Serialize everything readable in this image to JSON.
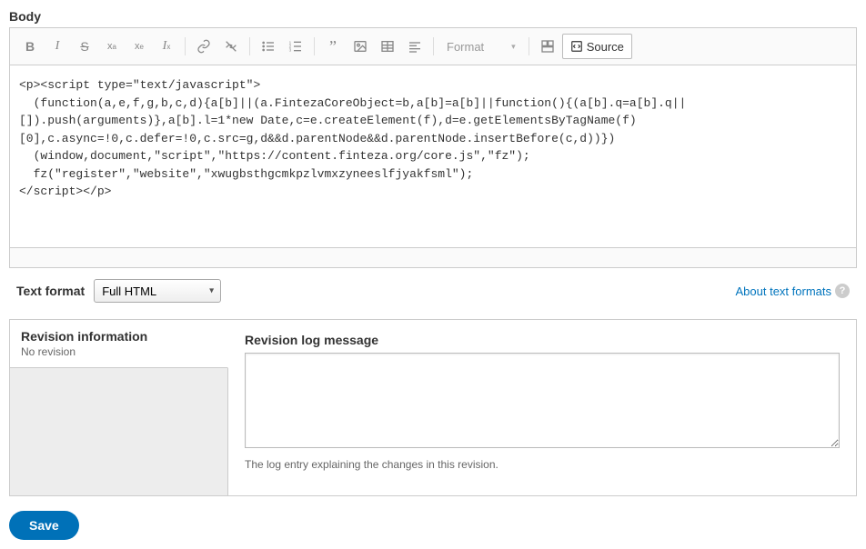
{
  "body_label": "Body",
  "toolbar": {
    "format_label": "Format",
    "source_label": "Source"
  },
  "editor_content": "<p><script type=\"text/javascript\">\n  (function(a,e,f,g,b,c,d){a[b]||(a.FintezaCoreObject=b,a[b]=a[b]||function(){(a[b].q=a[b].q||\n[]).push(arguments)},a[b].l=1*new Date,c=e.createElement(f),d=e.getElementsByTagName(f)\n[0],c.async=!0,c.defer=!0,c.src=g,d&&d.parentNode&&d.parentNode.insertBefore(c,d))})\n  (window,document,\"script\",\"https://content.finteza.org/core.js\",\"fz\");\n  fz(\"register\",\"website\",\"xwugbsthgcmkpzlvmxzyneeslfjyakfsml\");\n</script></p>",
  "text_format": {
    "label": "Text format",
    "selected": "Full HTML"
  },
  "about_link": "About text formats",
  "revision": {
    "tab_title": "Revision information",
    "tab_sub": "No revision",
    "log_label": "Revision log message",
    "log_value": "",
    "help": "The log entry explaining the changes in this revision."
  },
  "save_label": "Save"
}
